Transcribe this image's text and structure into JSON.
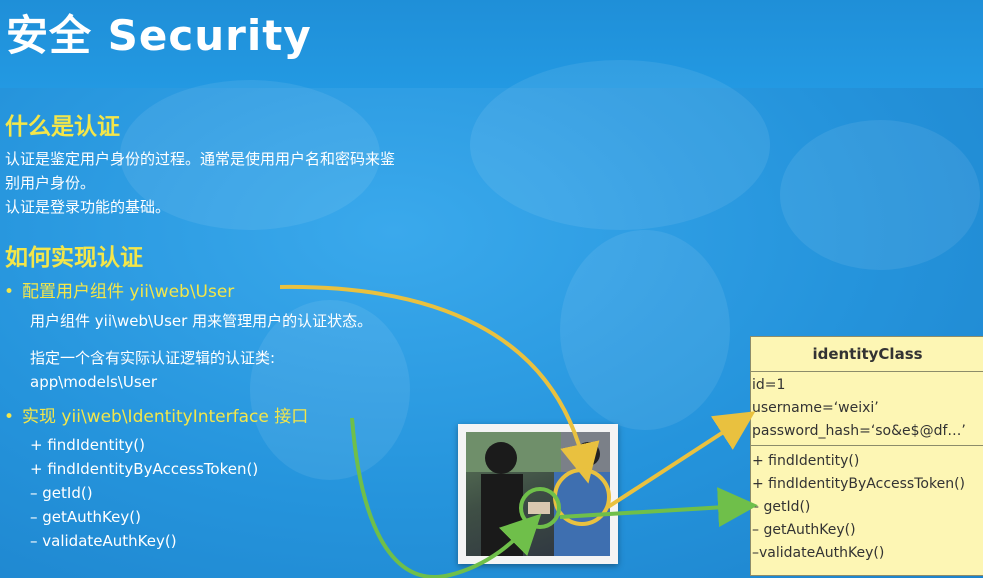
{
  "slide": {
    "title": "安全 Security",
    "section1": {
      "heading": "什么是认证",
      "lines": [
        "认证是鉴定用户身份的过程。通常是使用用户名和密码来鉴",
        "别用户身份。",
        "认证是登录功能的基础。"
      ]
    },
    "section2": {
      "heading": "如何实现认证",
      "bullet1": {
        "label": "配置用户组件 yii\\web\\User",
        "desc": "用户组件 yii\\web\\User 用来管理用户的认证状态。",
        "desc2": "指定一个含有实际认证逻辑的认证类:",
        "desc3": "app\\models\\User"
      },
      "bullet2": {
        "label": "实现 yii\\web\\IdentityInterface 接口",
        "methods": [
          "+ findIdentity()",
          "+ findIdentityByAccessToken()",
          "– getId()",
          "– getAuthKey()",
          "– validateAuthKey()"
        ]
      }
    },
    "bullet_symbol": "•"
  },
  "uml": {
    "title": "identityClass",
    "attributes": [
      "id=1",
      "username=‘weixi’",
      "password_hash=‘so&e$@df…’"
    ],
    "methods": [
      "+ findIdentity()",
      "+ findIdentityByAccessToken()",
      "– getId()",
      "– getAuthKey()",
      "–validateAuthKey()"
    ]
  },
  "colors": {
    "background": "#2594dc",
    "heading_yellow": "#f3e64a",
    "arrow_yellow": "#e9c13f",
    "arrow_green": "#6fbf4a",
    "uml_fill": "#fdf6b4"
  }
}
